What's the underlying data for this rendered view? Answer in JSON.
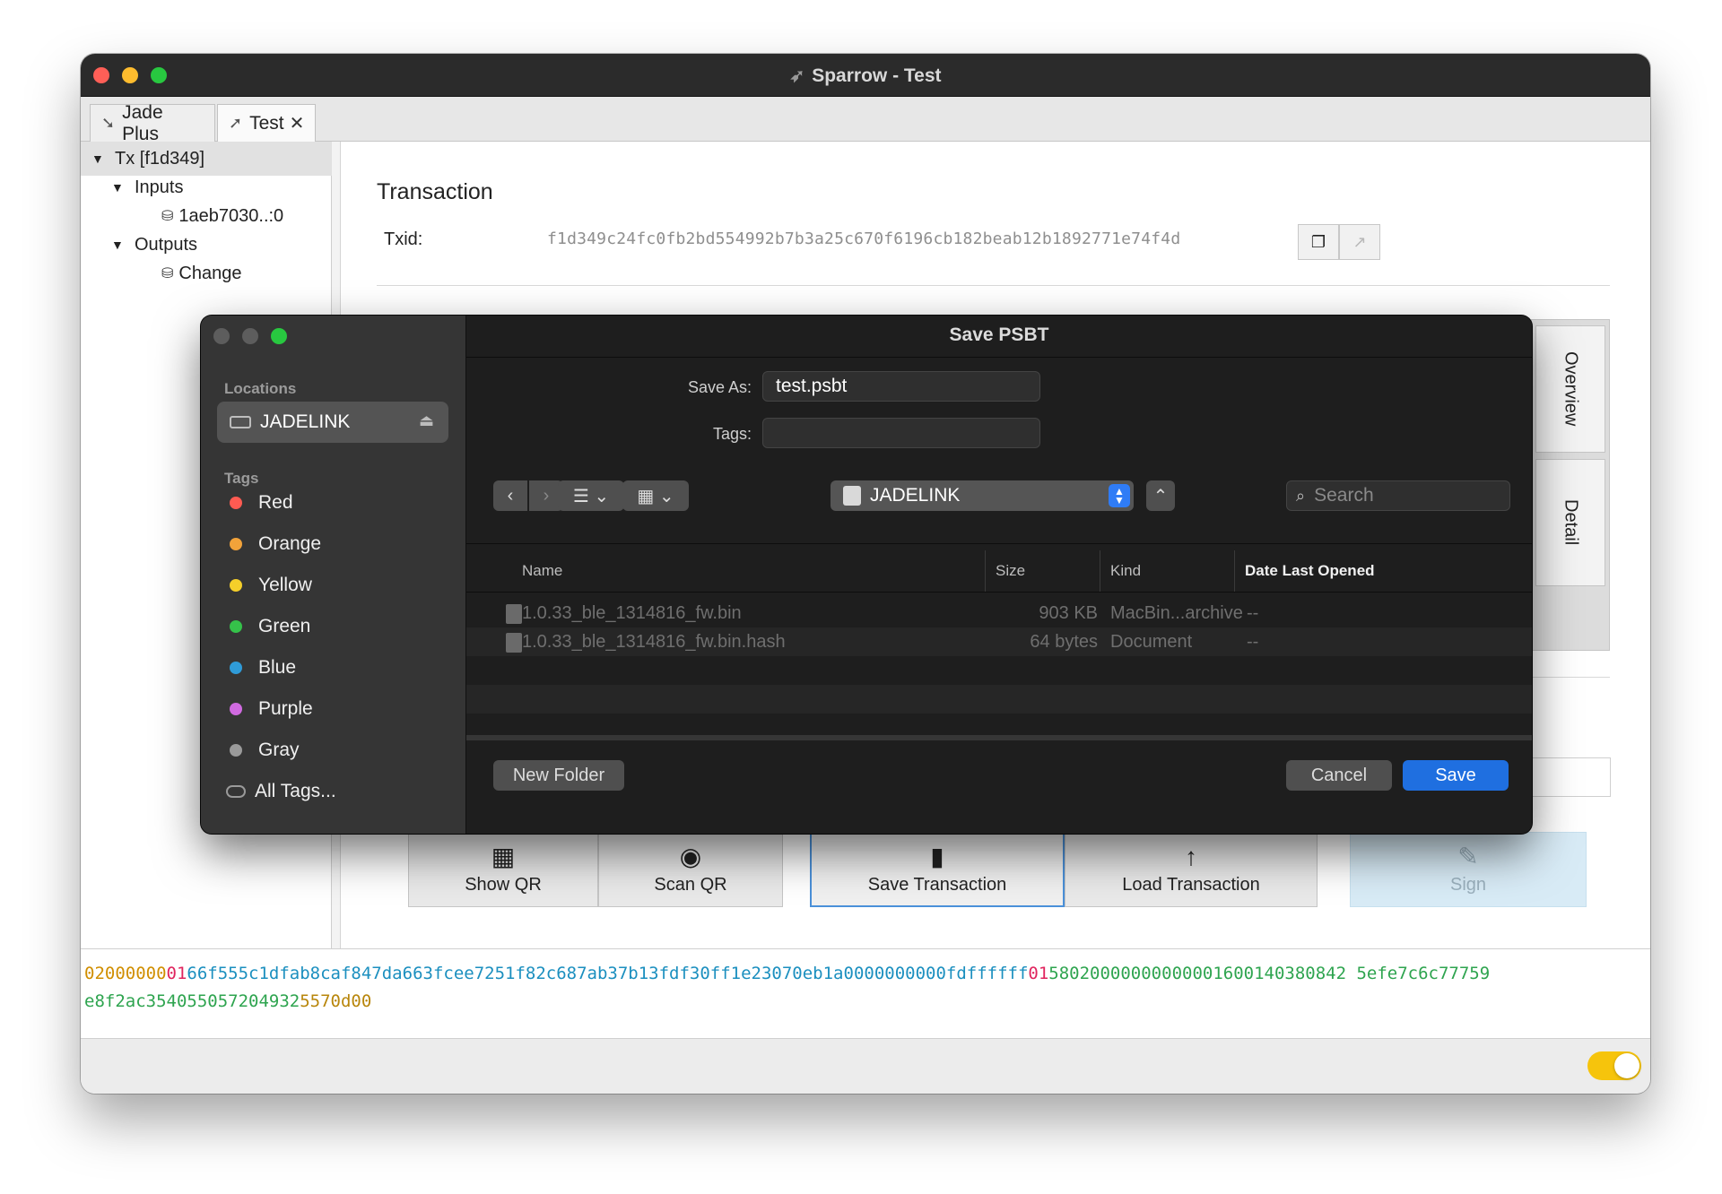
{
  "window": {
    "title": "Sparrow - Test",
    "tabs": [
      {
        "label": "Jade Plus",
        "icon": "wallet-icon"
      },
      {
        "label": "Test",
        "icon": "send-icon",
        "close": "✕"
      }
    ]
  },
  "tree": {
    "root": "Tx [f1d349]",
    "inputs_label": "Inputs",
    "input_item": "1aeb7030..:0",
    "outputs_label": "Outputs",
    "output_item": "Change"
  },
  "transaction": {
    "heading": "Transaction",
    "txid_label": "Txid:",
    "txid_value": "f1d349c24fc0fb2bd554992b7b3a25c670f6196cb182beab12b1892771e74f4d"
  },
  "side_tabs": {
    "overview": "Overview",
    "detail": "Detail"
  },
  "actions": [
    {
      "label": "Show QR",
      "icon": "qr-icon"
    },
    {
      "label": "Scan QR",
      "icon": "camera-icon"
    },
    {
      "label": "Save Transaction",
      "icon": "sd-card-icon"
    },
    {
      "label": "Load Transaction",
      "icon": "arrow-up-icon"
    },
    {
      "label": "Sign",
      "icon": "pen-icon"
    }
  ],
  "hex": {
    "line1": {
      "version": "02000000",
      "input_count": "01",
      "input": "66f555c1dfab8caf847da663fcee7251f82c687ab37b13fdf30ff1e23070eb1a0000000000fdffffff",
      "output_count": "01",
      "output": "58020000000000001600140380842 5efe7c6c77759"
    },
    "line2": {
      "output_cont": "e8f2ac354055057204932",
      "locktime": "5570d00"
    }
  },
  "colors": {
    "version": "#d08e00",
    "count": "#e0245e",
    "input": "#1b8fbf",
    "output": "#2ea44f",
    "locktime": "#b8860b",
    "save_button": "#1f6fe0",
    "toggle": "#f6c40c"
  },
  "dialog": {
    "title": "Save PSBT",
    "sidebar": {
      "locations_header": "Locations",
      "location": "JADELINK",
      "tags_header": "Tags",
      "tags": [
        {
          "label": "Red",
          "color": "#ff5b52"
        },
        {
          "label": "Orange",
          "color": "#f2a33a"
        },
        {
          "label": "Yellow",
          "color": "#f5cf2a"
        },
        {
          "label": "Green",
          "color": "#35c24a"
        },
        {
          "label": "Blue",
          "color": "#2f9bd8"
        },
        {
          "label": "Purple",
          "color": "#d06ae0"
        },
        {
          "label": "Gray",
          "color": "#9a9a9a"
        }
      ],
      "all_tags": "All Tags..."
    },
    "save_as_label": "Save As:",
    "save_as_value": "test.psbt",
    "tags_label": "Tags:",
    "tags_value": "",
    "location_popup": "JADELINK",
    "search_placeholder": "Search",
    "columns": [
      "Name",
      "Size",
      "Kind",
      "Date Last Opened"
    ],
    "files": [
      {
        "name": "1.0.33_ble_1314816_fw.bin",
        "size": "903 KB",
        "kind": "MacBin...archive",
        "date": "--"
      },
      {
        "name": "1.0.33_ble_1314816_fw.bin.hash",
        "size": "64 bytes",
        "kind": "Document",
        "date": "--"
      }
    ],
    "new_folder": "New Folder",
    "cancel": "Cancel",
    "save": "Save"
  }
}
